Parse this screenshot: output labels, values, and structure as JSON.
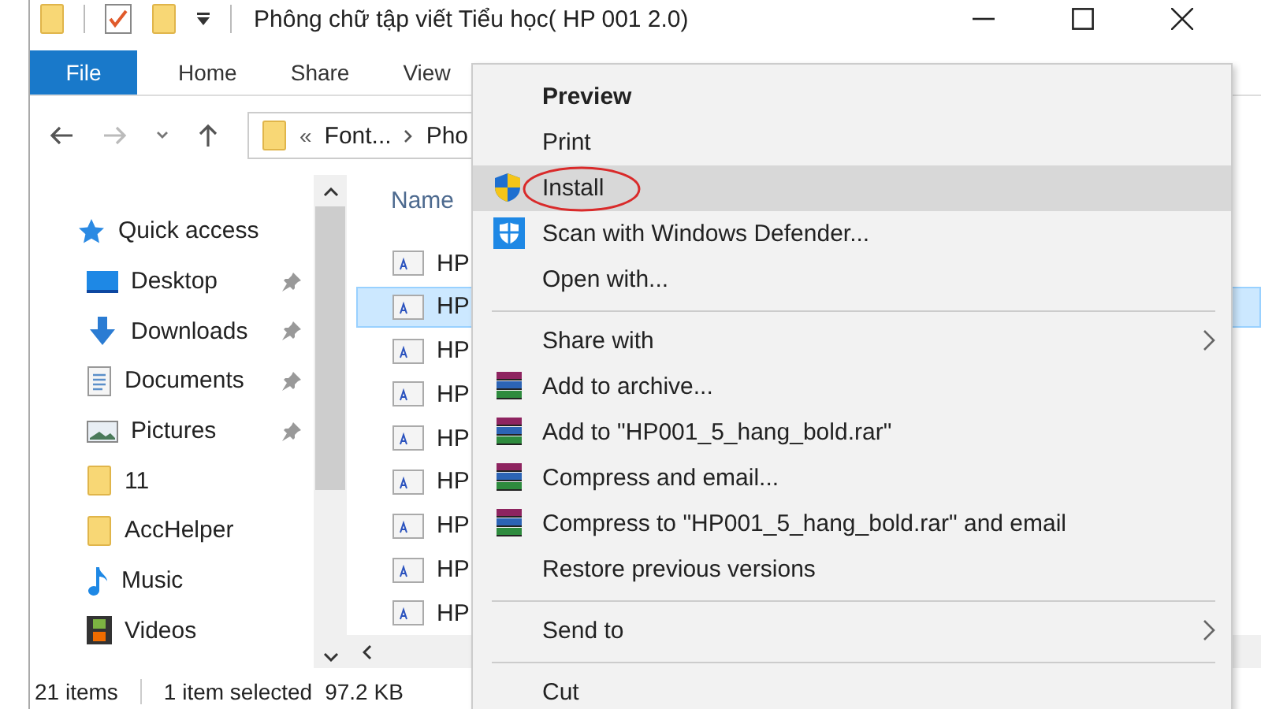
{
  "title_bar": {
    "title": "Phông chữ tập viết Tiểu học( HP 001 2.0)"
  },
  "ribbon_tabs": [
    {
      "label": "File",
      "kind": "file"
    },
    {
      "label": "Home",
      "kind": "tab"
    },
    {
      "label": "Share",
      "kind": "tab"
    },
    {
      "label": "View",
      "kind": "tab"
    }
  ],
  "address_bar": {
    "overflow_mark": "«",
    "crumbs": [
      "Font...",
      "Pho"
    ]
  },
  "navigation": [
    {
      "label": "Quick access",
      "kind": "star",
      "pinned": false
    },
    {
      "label": "Desktop",
      "kind": "desktop",
      "pinned": true
    },
    {
      "label": "Downloads",
      "kind": "download",
      "pinned": true
    },
    {
      "label": "Documents",
      "kind": "document",
      "pinned": true
    },
    {
      "label": "Pictures",
      "kind": "pictures",
      "pinned": true
    },
    {
      "label": "11",
      "kind": "folder",
      "pinned": false
    },
    {
      "label": "AccHelper",
      "kind": "folder",
      "pinned": false
    },
    {
      "label": "Music",
      "kind": "music",
      "pinned": false
    },
    {
      "label": "Videos",
      "kind": "video",
      "pinned": false
    }
  ],
  "file_list": {
    "header": "Name",
    "rows": [
      {
        "name": "HP",
        "selected": false
      },
      {
        "name": "HP",
        "selected": true
      },
      {
        "name": "HP",
        "selected": false
      },
      {
        "name": "HP",
        "selected": false
      },
      {
        "name": "HP",
        "selected": false
      },
      {
        "name": "HP",
        "selected": false
      },
      {
        "name": "HP",
        "selected": false
      },
      {
        "name": "HP",
        "selected": false
      },
      {
        "name": "HP",
        "selected": false
      }
    ]
  },
  "status_bar": {
    "item_count": "21 items",
    "selection": "1 item selected",
    "size": "97.2 KB"
  },
  "context_menu": {
    "items": [
      {
        "kind": "item",
        "label": "Preview",
        "default": true
      },
      {
        "kind": "item",
        "label": "Print"
      },
      {
        "kind": "shield_item",
        "label": "Install",
        "highlighted": true,
        "circled": true
      },
      {
        "kind": "defender_item",
        "label": "Scan with Windows Defender..."
      },
      {
        "kind": "item",
        "label": "Open with..."
      },
      {
        "kind": "separator"
      },
      {
        "kind": "item",
        "label": "Share with",
        "submenu": true
      },
      {
        "kind": "archive_item",
        "label": "Add to archive..."
      },
      {
        "kind": "archive_item",
        "label": "Add to \"HP001_5_hang_bold.rar\""
      },
      {
        "kind": "archive_item",
        "label": "Compress and email..."
      },
      {
        "kind": "archive_item",
        "label": "Compress to \"HP001_5_hang_bold.rar\" and email"
      },
      {
        "kind": "item",
        "label": "Restore previous versions"
      },
      {
        "kind": "separator"
      },
      {
        "kind": "item",
        "label": "Send to",
        "submenu": true
      },
      {
        "kind": "separator"
      },
      {
        "kind": "item",
        "label": "Cut"
      }
    ]
  }
}
